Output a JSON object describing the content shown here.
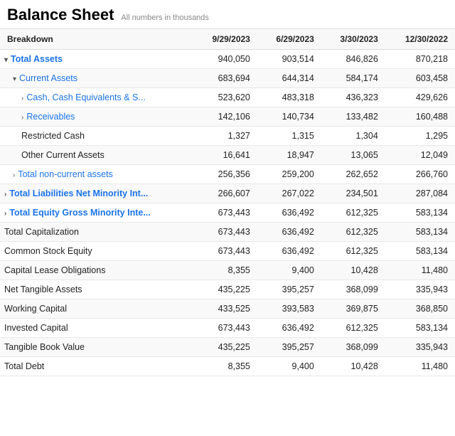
{
  "header": {
    "title": "Balance Sheet",
    "subtitle": "All numbers in thousands"
  },
  "columns": [
    "Breakdown",
    "9/29/2023",
    "6/29/2023",
    "3/30/2023",
    "12/30/2022"
  ],
  "rows": [
    {
      "label": "Total Assets",
      "level": 0,
      "toggle": "down",
      "values": [
        "940,050",
        "903,514",
        "846,826",
        "870,218"
      ],
      "bold": false,
      "blue": false
    },
    {
      "label": "Current Assets",
      "level": 1,
      "toggle": "down",
      "values": [
        "683,694",
        "644,314",
        "584,174",
        "603,458"
      ],
      "bold": false,
      "blue": false
    },
    {
      "label": "Cash, Cash Equivalents & S...",
      "level": 2,
      "toggle": "right",
      "values": [
        "523,620",
        "483,318",
        "436,323",
        "429,626"
      ],
      "bold": false,
      "blue": false
    },
    {
      "label": "Receivables",
      "level": 2,
      "toggle": "right",
      "values": [
        "142,106",
        "140,734",
        "133,482",
        "160,488"
      ],
      "bold": false,
      "blue": false
    },
    {
      "label": "Restricted Cash",
      "level": 2,
      "toggle": null,
      "values": [
        "1,327",
        "1,315",
        "1,304",
        "1,295"
      ],
      "bold": false,
      "blue": false
    },
    {
      "label": "Other Current Assets",
      "level": 2,
      "toggle": null,
      "values": [
        "16,641",
        "18,947",
        "13,065",
        "12,049"
      ],
      "bold": false,
      "blue": false
    },
    {
      "label": "Total non-current assets",
      "level": 1,
      "toggle": "right",
      "values": [
        "256,356",
        "259,200",
        "262,652",
        "266,760"
      ],
      "bold": false,
      "blue": false
    },
    {
      "label": "Total Liabilities Net Minority Int...",
      "level": 0,
      "toggle": "right",
      "values": [
        "266,607",
        "267,022",
        "234,501",
        "287,084"
      ],
      "bold": false,
      "blue": false
    },
    {
      "label": "Total Equity Gross Minority Inte...",
      "level": 0,
      "toggle": "right",
      "values": [
        "673,443",
        "636,492",
        "612,325",
        "583,134"
      ],
      "bold": false,
      "blue": false
    },
    {
      "label": "Total Capitalization",
      "level": "flat",
      "toggle": null,
      "values": [
        "673,443",
        "636,492",
        "612,325",
        "583,134"
      ],
      "bold": false,
      "blue": false
    },
    {
      "label": "Common Stock Equity",
      "level": "flat",
      "toggle": null,
      "values": [
        "673,443",
        "636,492",
        "612,325",
        "583,134"
      ],
      "bold": false,
      "blue": false
    },
    {
      "label": "Capital Lease Obligations",
      "level": "flat",
      "toggle": null,
      "values": [
        "8,355",
        "9,400",
        "10,428",
        "11,480"
      ],
      "bold": false,
      "blue": false
    },
    {
      "label": "Net Tangible Assets",
      "level": "flat",
      "toggle": null,
      "values": [
        "435,225",
        "395,257",
        "368,099",
        "335,943"
      ],
      "bold": false,
      "blue": false
    },
    {
      "label": "Working Capital",
      "level": "flat",
      "toggle": null,
      "values": [
        "433,525",
        "393,583",
        "369,875",
        "368,850"
      ],
      "bold": false,
      "blue": false
    },
    {
      "label": "Invested Capital",
      "level": "flat",
      "toggle": null,
      "values": [
        "673,443",
        "636,492",
        "612,325",
        "583,134"
      ],
      "bold": false,
      "blue": false
    },
    {
      "label": "Tangible Book Value",
      "level": "flat",
      "toggle": null,
      "values": [
        "435,225",
        "395,257",
        "368,099",
        "335,943"
      ],
      "bold": false,
      "blue": false
    },
    {
      "label": "Total Debt",
      "level": "flat",
      "toggle": null,
      "values": [
        "8,355",
        "9,400",
        "10,428",
        "11,480"
      ],
      "bold": false,
      "blue": false
    }
  ]
}
